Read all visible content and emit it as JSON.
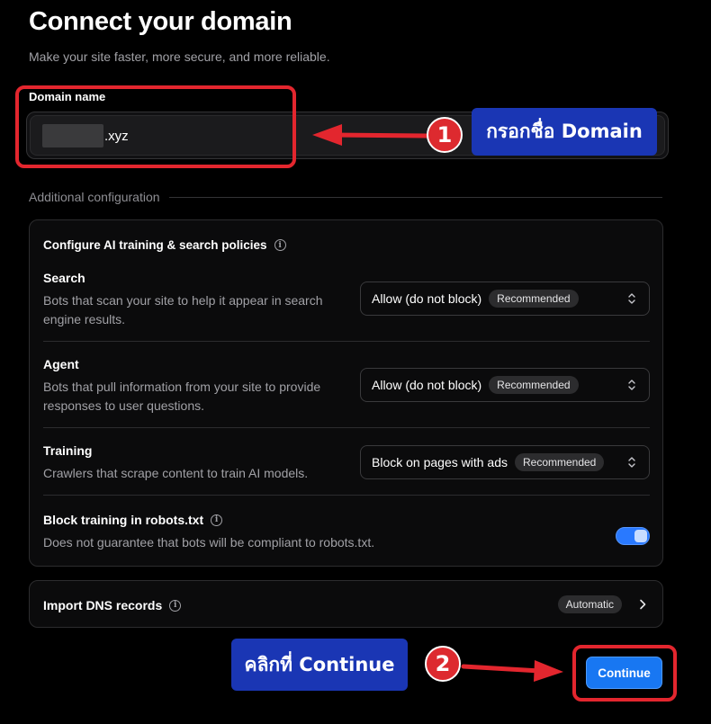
{
  "header": {
    "title": "Connect your domain",
    "subtitle": "Make your site faster, more secure, and more reliable."
  },
  "domain_field": {
    "label": "Domain name",
    "value_suffix": ".xyz"
  },
  "additional_config": {
    "section_label": "Additional configuration",
    "card_title": "Configure AI training & search policies",
    "rows": [
      {
        "title": "Search",
        "description": "Bots that scan your site to help it appear in search engine results.",
        "selected": "Allow (do not block)",
        "badge": "Recommended"
      },
      {
        "title": "Agent",
        "description": "Bots that pull information from your site to provide responses to user questions.",
        "selected": "Allow (do not block)",
        "badge": "Recommended"
      },
      {
        "title": "Training",
        "description": "Crawlers that scrape content to train AI models.",
        "selected": "Block on pages with ads",
        "badge": "Recommended"
      }
    ],
    "robots_toggle": {
      "title": "Block training in robots.txt",
      "description": "Does not guarantee that bots will be compliant to robots.txt.",
      "enabled": true
    }
  },
  "dns_import": {
    "title": "Import DNS records",
    "badge": "Automatic"
  },
  "actions": {
    "continue_label": "Continue"
  },
  "annotations": {
    "step1_number": "1",
    "step1_label": "กรอกชื่อ Domain",
    "step2_number": "2",
    "step2_label": "คลิกที่ Continue"
  },
  "colors": {
    "background": "#000000",
    "accent_blue": "#1877f2",
    "annotation_red": "#e3262e",
    "annotation_label_blue": "#1a36b4"
  }
}
